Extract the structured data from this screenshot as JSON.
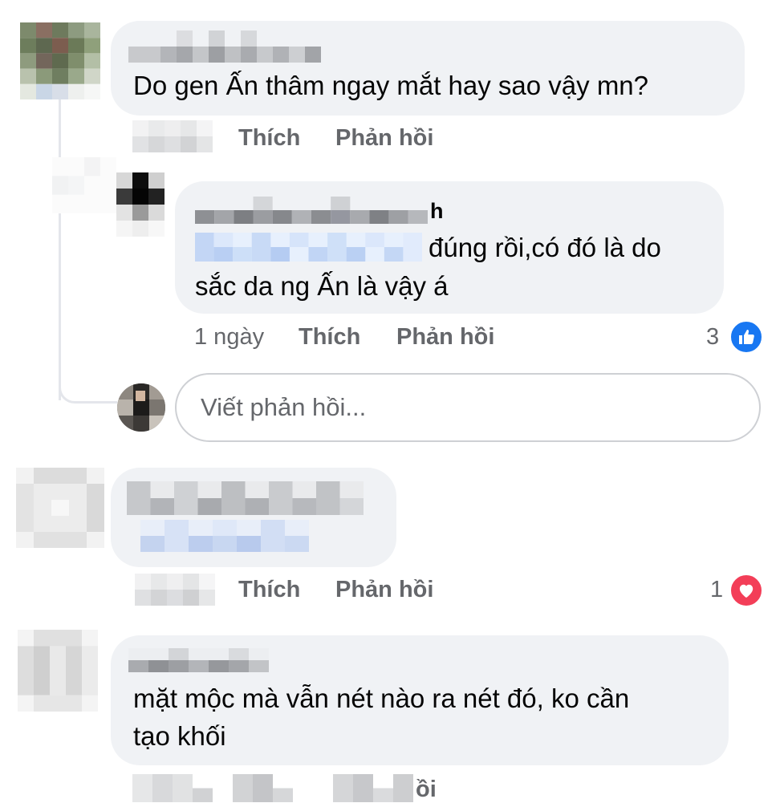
{
  "comment1": {
    "text": "Do gen Ấn thâm ngay mắt hay sao vậy mn?",
    "actions": {
      "like": "Thích",
      "reply": "Phản hồi"
    }
  },
  "reply1": {
    "name_tail": "h",
    "text_line1": "đúng rồi,có đó là do",
    "text_line2": "sắc da ng Ấn là vậy á",
    "time": "1 ngày",
    "actions": {
      "like": "Thích",
      "reply": "Phản hồi"
    },
    "reaction_count": "3",
    "reaction_icon": "like-icon",
    "reaction_color": "#1877f2"
  },
  "reply_input": {
    "placeholder": "Viết phản hồi..."
  },
  "comment2": {
    "actions": {
      "like": "Thích",
      "reply": "Phản hồi"
    },
    "reaction_count": "1",
    "reaction_icon": "heart-icon",
    "reaction_color": "#f33e58"
  },
  "comment3": {
    "text_line1": "mặt mộc mà vẫn nét nào ra nét đó, ko cần",
    "text_line2": "tạo khối",
    "actions_tail": "ồi"
  }
}
